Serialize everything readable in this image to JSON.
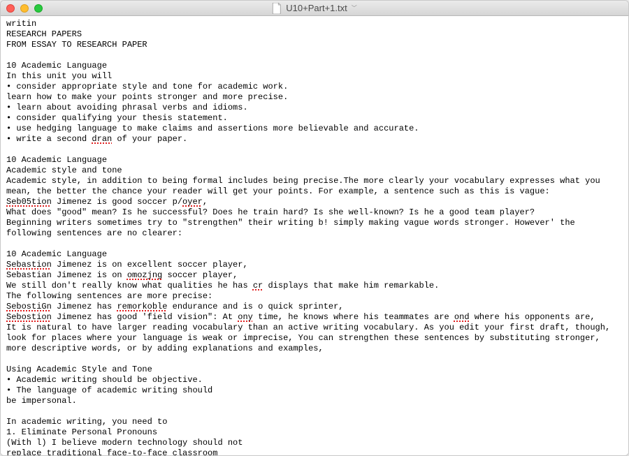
{
  "window": {
    "title": "U10+Part+1.txt"
  },
  "content": {
    "l1": "writin",
    "l2": "RESEARCH PAPERS",
    "l3": "FROM ESSAY TO RESEARCH PAPER",
    "l4": "10 Academic Language",
    "l5": "In this unit you will",
    "l6": "• consider appropriate style and tone for academic work.",
    "l7": "learn how to make your points stronger and more precise.",
    "l8": "• learn about avoiding phrasal verbs and idioms.",
    "l9": "• consider qualifying your thesis statement.",
    "l10": "• use hedging language to make claims and assertions more believable and accurate.",
    "l11a": "• write a second ",
    "l11s": "dran",
    "l11b": " of your paper.",
    "l12": "10 Academic Language",
    "l13": "Academic style and tone",
    "l14": "Academic style, in addition to being formal includes being precise.The more clearly your vocabulary expresses what you mean, the better the chance your reader will get your points. For example, a sentence such as this is vague:",
    "l15s1": "Seb05tion",
    "l15a": " Jimenez is good soccer p/",
    "l15s2": "oyer",
    "l15b": ",",
    "l16": "What does \"good\" mean? Is he successful? Does he train hard? Is she well-known? Is he a good team player?",
    "l17": "Beginning writers sometimes try to \"strengthen\" their writing b! simply making vague words stronger. However' the following sentences are no clearer:",
    "l18": "10 Academic Language",
    "l19s": "Sebastion",
    "l19a": " Jimenez is on excellent soccer player,",
    "l20a": "Sebastian Jimenez is on ",
    "l20s": "omozjng",
    "l20b": " soccer player,",
    "l21a": "We still don't really know what qualities he has ",
    "l21s": "cr",
    "l21b": " displays that make him remarkable.",
    "l22": "The following sentences are more precise:",
    "l23s1": "SebostiGn",
    "l23a": " Jimenez has ",
    "l23s2": "remorkoble",
    "l23b": " endurance and is o quick sprinter,",
    "l24s": "Sebostion",
    "l24a": " Jimenez has good 'field vision\": At ",
    "l24s2": "ony",
    "l24b": " time, he knows where his teammates are ",
    "l24s3": "ond",
    "l24c": " where his opponents are,",
    "l25": "It is natural to have larger reading vocabulary than an active writing vocabulary. As you edit your first draft, though, look for places where your language is weak or imprecise, You can strengthen these sentences by substituting stronger, more descriptive words, or by adding explanations and examples,",
    "l26": "Using Academic Style and Tone",
    "l27": "• Academic writing should be objective.",
    "l28": "• The language of academic writing should",
    "l29": "be impersonal.",
    "l30": "In academic writing, you need to",
    "l31": "1. Eliminate Personal Pronouns",
    "l32": "(With l) I believe modern technology should not",
    "l33": "replace traditional face-to-face classroom"
  }
}
